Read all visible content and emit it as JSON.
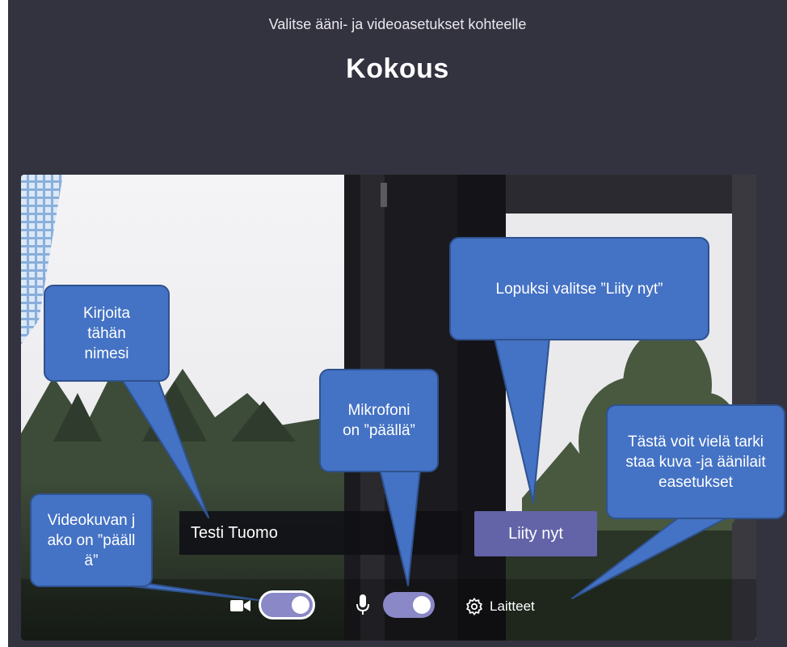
{
  "header": {
    "subtitle": "Valitse ääni- ja videoasetukset kohteelle",
    "title": "Kokous"
  },
  "form": {
    "name_value": "Testi Tuomo",
    "join_label": "Liity nyt"
  },
  "controls": {
    "camera_on": true,
    "mic_on": true,
    "devices_label": "Laitteet"
  },
  "callouts": {
    "name_hint": "Kirjoita tähän nimesi",
    "join_hint": "Lopuksi valitse ”Liity nyt”",
    "mic_hint": "Mikrofoni on ”päällä”",
    "devices_hint": "Tästä voit vielä tarkistaa kuva -ja äänilaiteasetukset",
    "video_hint": "Videokuvan jako on ”päällä”"
  },
  "colors": {
    "background": "#33323f",
    "accent": "#6264a7",
    "toggle_on": "#8a88c6",
    "callout_fill": "#4472c4"
  }
}
